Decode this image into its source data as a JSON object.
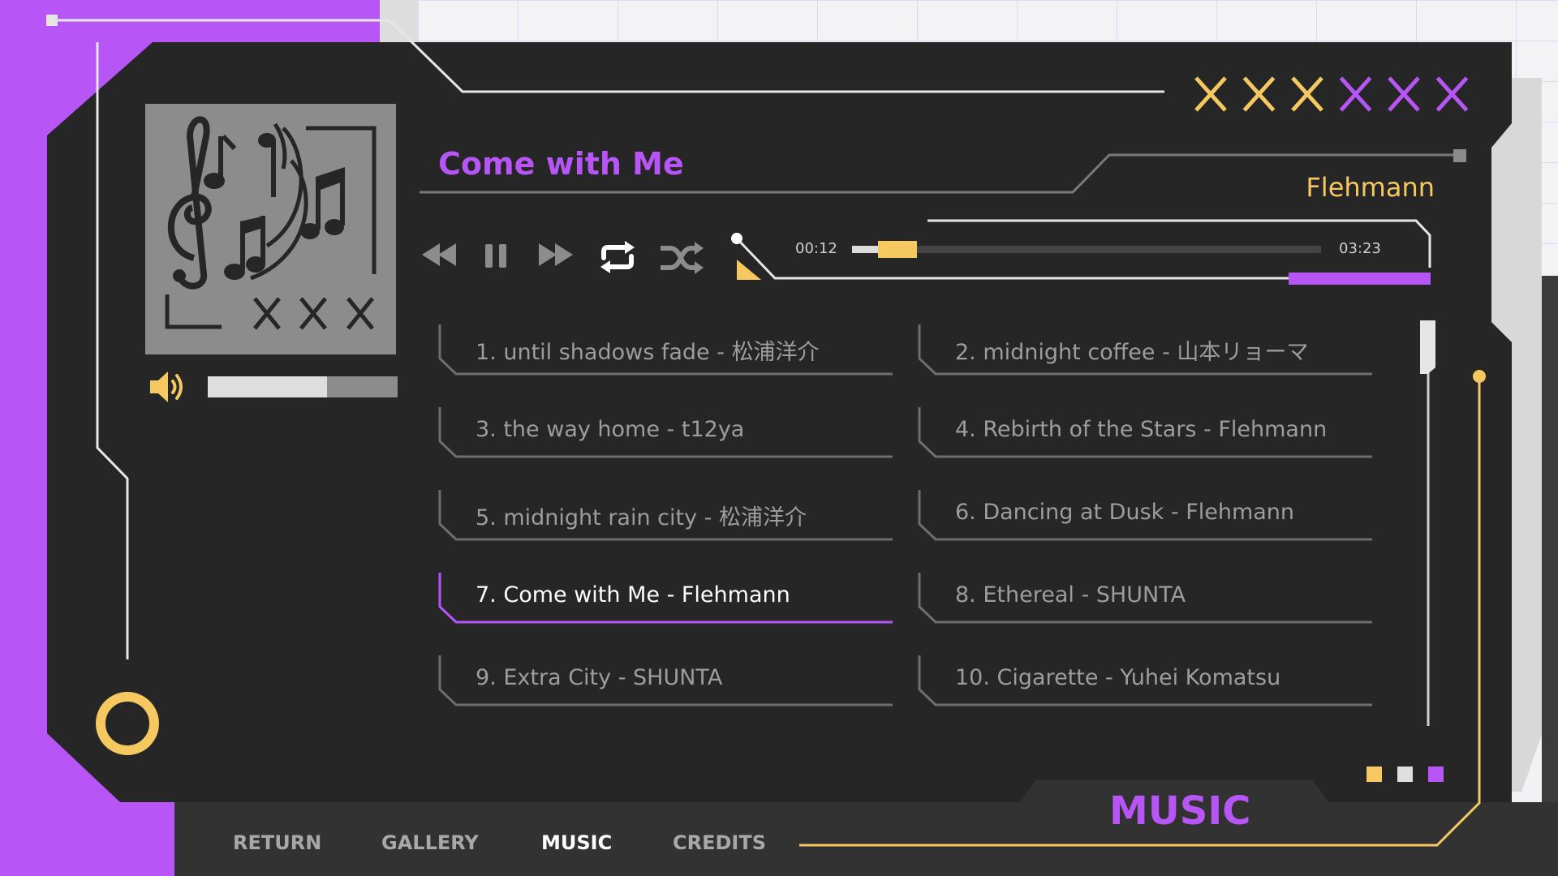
{
  "now_playing": {
    "title": "Come with Me",
    "artist": "Flehmann",
    "elapsed": "00:12",
    "total": "03:23",
    "progress": 0.06
  },
  "volume": {
    "level": 0.63
  },
  "controls": {
    "rewind_icon": "rewind-icon",
    "pause_icon": "pause-icon",
    "forward_icon": "fast-forward-icon",
    "repeat_icon": "repeat-icon",
    "shuffle_icon": "shuffle-icon"
  },
  "header_marks": [
    "yellow-x",
    "yellow-x",
    "yellow-x",
    "purple-x",
    "purple-x",
    "purple-x"
  ],
  "tracks": [
    {
      "label": "1. until shadows fade - 松浦洋介",
      "active": false
    },
    {
      "label": "2. midnight coffee - 山本リョーマ",
      "active": false
    },
    {
      "label": "3. the way home - t12ya",
      "active": false
    },
    {
      "label": "4. Rebirth of the Stars - Flehmann",
      "active": false
    },
    {
      "label": "5. midnight rain city - 松浦洋介",
      "active": false
    },
    {
      "label": "6. Dancing at Dusk - Flehmann",
      "active": false
    },
    {
      "label": "7. Come with Me - Flehmann",
      "active": true
    },
    {
      "label": "8. Ethereal - SHUNTA",
      "active": false
    },
    {
      "label": "9. Extra City - SHUNTA",
      "active": false
    },
    {
      "label": "10. Cigarette - Yuhei Komatsu",
      "active": false
    }
  ],
  "nav": {
    "return": "RETURN",
    "gallery": "GALLERY",
    "music": "MUSIC",
    "credits": "CREDITS",
    "active": "MUSIC"
  },
  "section_heading": "MUSIC",
  "colors": {
    "accent_purple": "#b755f7",
    "accent_yellow": "#f5c960",
    "panel": "#262626",
    "bar": "#323232"
  }
}
